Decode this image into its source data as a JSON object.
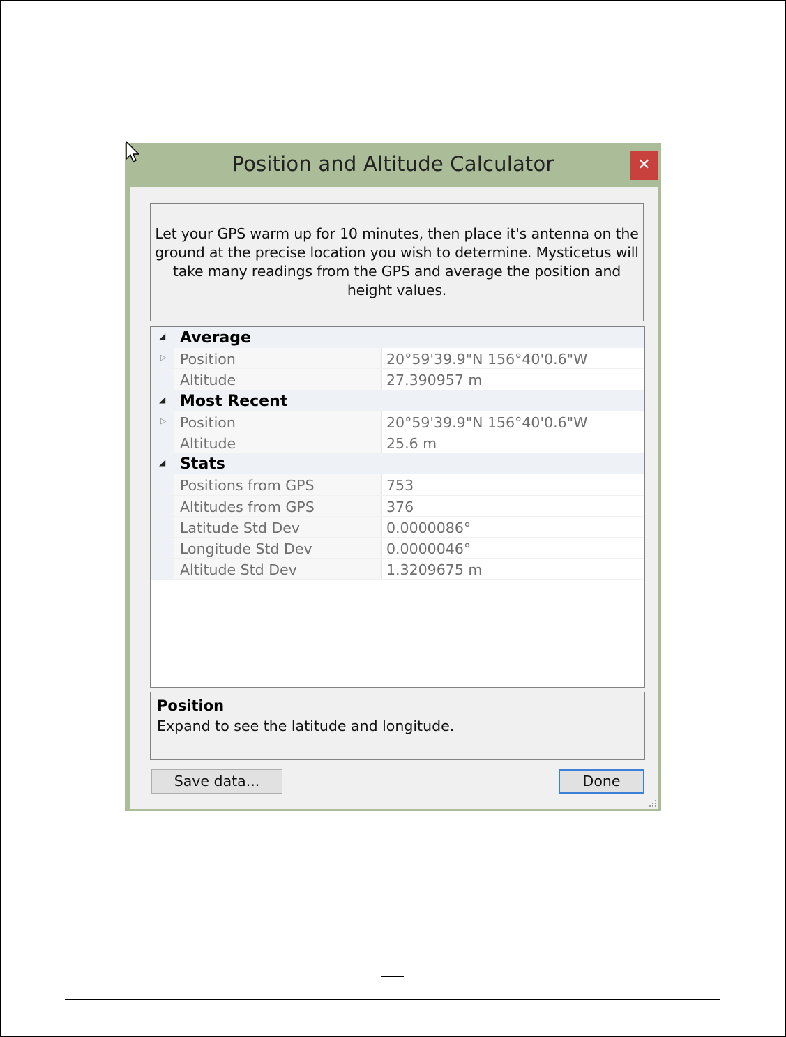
{
  "dialog": {
    "title": "Position and Altitude Calculator",
    "close_glyph": "✕",
    "titlebar_color": "#aabd98",
    "close_color": "#c8413c"
  },
  "description": "Let your GPS warm up for 10 minutes, then place it's antenna on the ground at the precise location you wish to determine. Mysticetus will take many readings from the GPS and average the position and height values.",
  "grid": {
    "average": {
      "label": "Average",
      "position": {
        "name": "Position",
        "value": "20°59'39.9\"N 156°40'0.6\"W"
      },
      "altitude": {
        "name": "Altitude",
        "value": "27.390957 m"
      }
    },
    "most_recent": {
      "label": "Most Recent",
      "position": {
        "name": "Position",
        "value": "20°59'39.9\"N 156°40'0.6\"W"
      },
      "altitude": {
        "name": "Altitude",
        "value": "25.6 m"
      }
    },
    "stats": {
      "label": "Stats",
      "positions_from_gps": {
        "name": "Positions from GPS",
        "value": "753"
      },
      "altitudes_from_gps": {
        "name": "Altitudes from GPS",
        "value": "376"
      },
      "latitude_std_dev": {
        "name": "Latitude Std Dev",
        "value": "0.0000086°"
      },
      "longitude_std_dev": {
        "name": "Longitude Std Dev",
        "value": "0.0000046°"
      },
      "altitude_std_dev": {
        "name": "Altitude Std Dev",
        "value": "1.3209675 m"
      }
    }
  },
  "help": {
    "title": "Position",
    "text": "Expand to see the latitude and longitude."
  },
  "buttons": {
    "save": "Save data...",
    "done": "Done"
  }
}
